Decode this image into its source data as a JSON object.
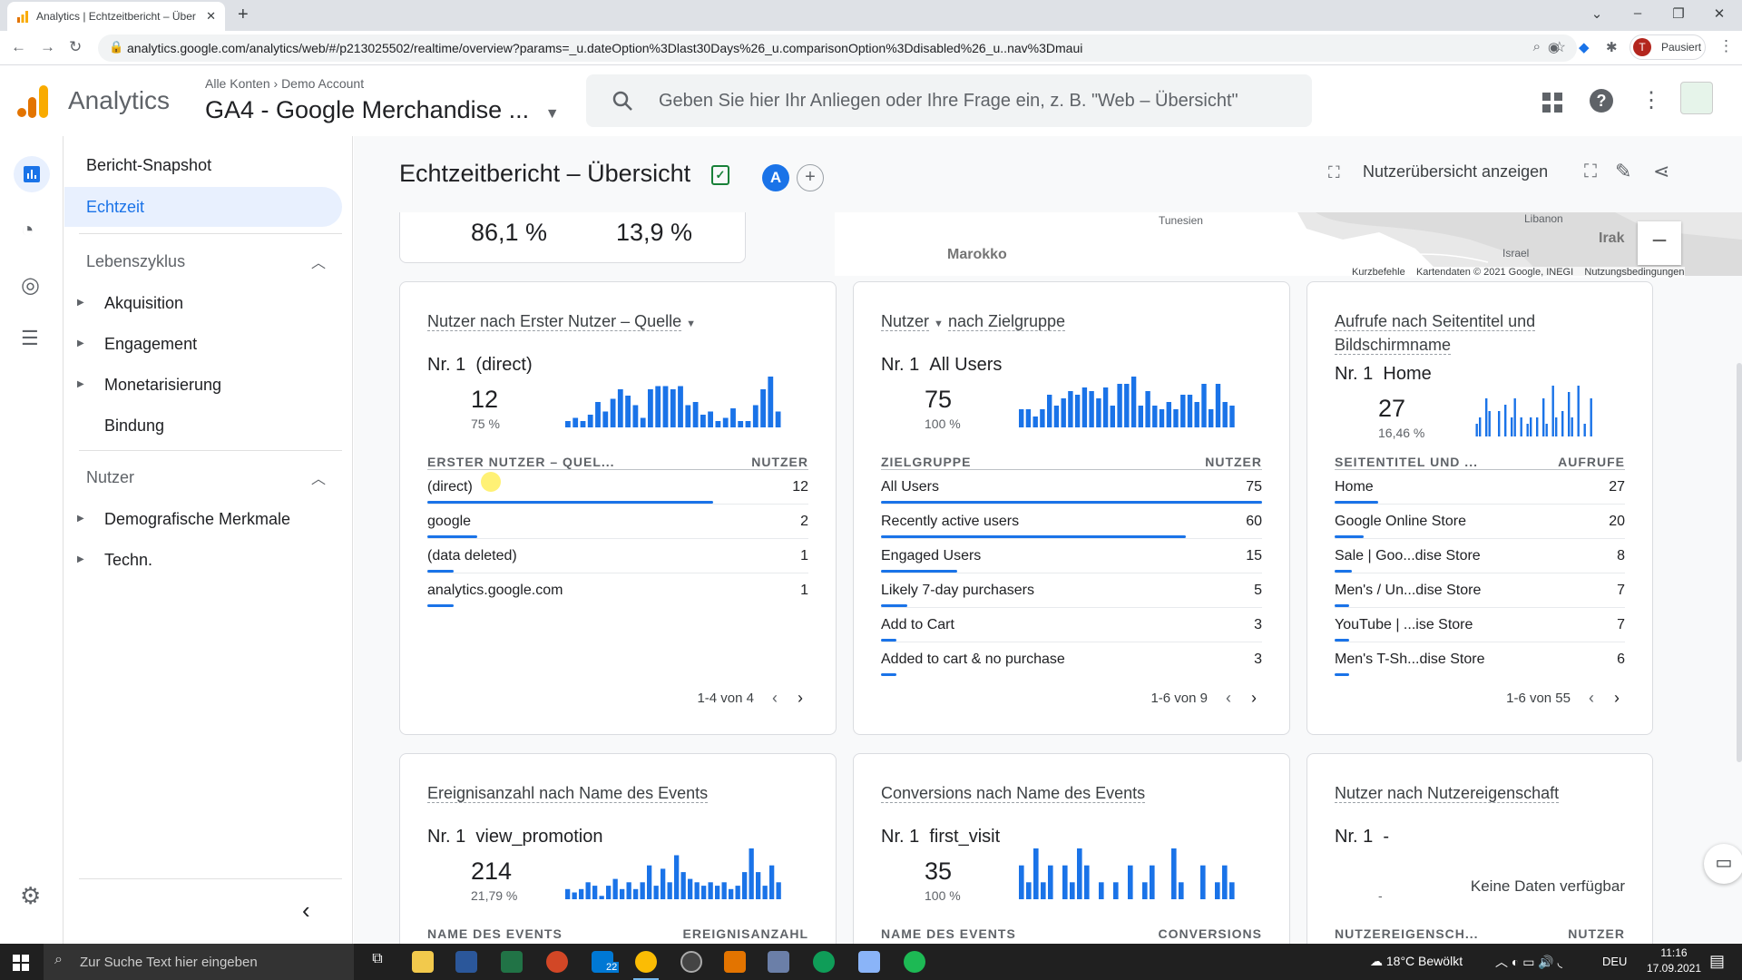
{
  "browser": {
    "tab_title": "Analytics | Echtzeitbericht – Über",
    "url": "analytics.google.com/analytics/web/#/p213025502/realtime/overview?params=_u.dateOption%3Dlast30Days%26_u.comparisonOption%3Ddisabled%26_u..nav%3Dmaui",
    "profile_initial": "T",
    "profile_status": "Pausiert"
  },
  "header": {
    "app_name": "Analytics",
    "breadcrumb_root": "Alle Konten",
    "breadcrumb_account": "Demo Account",
    "property": "GA4 - Google Merchandise ...",
    "search_placeholder": "Geben Sie hier Ihr Anliegen oder Ihre Frage ein, z. B. \"Web – Übersicht\""
  },
  "sidebar": {
    "items": [
      "Bericht-Snapshot",
      "Echtzeit"
    ],
    "sections": [
      {
        "title": "Lebenszyklus",
        "items": [
          "Akquisition",
          "Engagement",
          "Monetarisierung",
          "Bindung"
        ]
      },
      {
        "title": "Nutzer",
        "items": [
          "Demografische Merkmale",
          "Techn."
        ]
      }
    ]
  },
  "page": {
    "title": "Echtzeitbericht – Übersicht",
    "avatar": "A",
    "user_overview": "Nutzerübersicht anzeigen"
  },
  "device": {
    "pct1": "86,1 %",
    "pct2": "13,9 %"
  },
  "map": {
    "labels": [
      "Tunesien",
      "Marokko",
      "Libanon",
      "Israel",
      "Irak"
    ],
    "footer": [
      "Kurzbefehle",
      "Kartendaten © 2021 Google, INEGI",
      "Nutzungsbedingungen"
    ]
  },
  "cards": [
    {
      "title_a": "Nutzer nach Erster Nutzer – Quelle",
      "title_b": "",
      "top_rank": "Nr. 1",
      "top_name": "(direct)",
      "value": "12",
      "pct": "75 %",
      "col1": "ERSTER NUTZER – QUEL...",
      "col2": "NUTZER",
      "pager": "1-4 von 4",
      "spark": [
        2,
        3,
        2,
        4,
        8,
        5,
        9,
        12,
        10,
        7,
        3,
        12,
        13,
        13,
        12,
        13,
        7,
        8,
        4,
        5,
        2,
        3,
        6,
        2,
        2,
        7,
        12,
        16,
        5
      ],
      "rows": [
        {
          "label": "(direct)",
          "value": "12",
          "share": 0.75
        },
        {
          "label": "google",
          "value": "2",
          "share": 0.13
        },
        {
          "label": "(data deleted)",
          "value": "1",
          "share": 0.07
        },
        {
          "label": "analytics.google.com",
          "value": "1",
          "share": 0.07
        }
      ]
    },
    {
      "title_a": "Nutzer",
      "title_b": "nach Zielgruppe",
      "top_rank": "Nr. 1",
      "top_name": "All Users",
      "value": "75",
      "pct": "100 %",
      "col1": "ZIELGRUPPE",
      "col2": "NUTZER",
      "pager": "1-6 von 9",
      "spark": [
        5,
        5,
        3,
        5,
        9,
        6,
        8,
        10,
        9,
        11,
        10,
        8,
        11,
        6,
        12,
        12,
        14,
        6,
        10,
        6,
        5,
        7,
        5,
        9,
        9,
        7,
        12,
        5,
        12,
        7,
        6
      ],
      "rows": [
        {
          "label": "All Users",
          "value": "75",
          "share": 1
        },
        {
          "label": "Recently active users",
          "value": "60",
          "share": 0.8
        },
        {
          "label": "Engaged Users",
          "value": "15",
          "share": 0.2
        },
        {
          "label": "Likely 7-day purchasers",
          "value": "5",
          "share": 0.07
        },
        {
          "label": "Add to Cart",
          "value": "3",
          "share": 0.04
        },
        {
          "label": "Added to cart & no purchase",
          "value": "3",
          "share": 0.04
        }
      ]
    },
    {
      "title_a": "Aufrufe nach Seitentitel und Bildschirmname",
      "title_b": "",
      "top_rank": "Nr. 1",
      "top_name": "Home",
      "value": "27",
      "pct": "16,46 %",
      "col1": "SEITENTITEL UND ...",
      "col2": "AUFRUFE",
      "pager": "1-6 von 55",
      "spark": [
        0,
        2,
        3,
        0,
        6,
        4,
        0,
        0,
        4,
        0,
        5,
        0,
        3,
        6,
        0,
        3,
        0,
        2,
        3,
        0,
        3,
        0,
        6,
        2,
        0,
        8,
        3,
        0,
        4,
        0,
        7,
        3,
        0,
        8,
        0,
        2,
        0,
        6,
        0,
        0
      ],
      "rows": [
        {
          "label": "Home",
          "value": "27",
          "share": 0.15
        },
        {
          "label": "Google Online Store",
          "value": "20",
          "share": 0.1
        },
        {
          "label": "Sale | Goo...dise Store",
          "value": "8",
          "share": 0.06
        },
        {
          "label": "Men's / Un...dise Store",
          "value": "7",
          "share": 0.05
        },
        {
          "label": "YouTube | ...ise Store",
          "value": "7",
          "share": 0.05
        },
        {
          "label": "Men's T-Sh...dise Store",
          "value": "6",
          "share": 0.05
        }
      ]
    },
    {
      "title_a": "Ereignisanzahl nach Name des Events",
      "title_b": "",
      "top_rank": "Nr. 1",
      "top_name": "view_promotion",
      "value": "214",
      "pct": "21,79 %",
      "col1": "NAME DES EVENTS",
      "col2": "EREIGNISANZAHL",
      "pager": "",
      "spark": [
        3,
        2,
        3,
        5,
        4,
        1,
        4,
        6,
        3,
        5,
        3,
        5,
        10,
        4,
        9,
        5,
        13,
        8,
        6,
        5,
        4,
        5,
        4,
        5,
        3,
        4,
        8,
        15,
        8,
        4,
        10,
        5
      ],
      "rows": []
    },
    {
      "title_a": "Conversions nach Name des Events",
      "title_b": "",
      "top_rank": "Nr. 1",
      "top_name": "first_visit",
      "value": "35",
      "pct": "100 %",
      "col1": "NAME DES EVENTS",
      "col2": "CONVERSIONS",
      "pager": "",
      "spark": [
        2,
        1,
        3,
        1,
        2,
        0,
        2,
        1,
        3,
        2,
        0,
        1,
        0,
        1,
        0,
        2,
        0,
        1,
        2,
        0,
        0,
        3,
        1,
        0,
        0,
        2,
        0,
        1,
        2,
        1
      ],
      "rows": []
    },
    {
      "title_a": "Nutzer nach Nutzereigenschaft",
      "title_b": "",
      "top_rank": "Nr. 1",
      "top_name": "-",
      "value": "",
      "pct": "-",
      "col1": "NUTZEREIGENSCH...",
      "col2": "NUTZER",
      "pager": "",
      "nodata": "Keine Daten verfügbar",
      "spark": [],
      "rows": []
    }
  ],
  "taskbar": {
    "search_placeholder": "Zur Suche Text hier eingeben",
    "weather": "18°C  Bewölkt",
    "lang": "DEU",
    "time": "11:16",
    "date": "17.09.2021",
    "mail_badge": "22"
  },
  "colors": {
    "accent": "#1a73e8",
    "analytics_orange": "#f9ab00",
    "selected_nav": "#e8f0fe"
  }
}
